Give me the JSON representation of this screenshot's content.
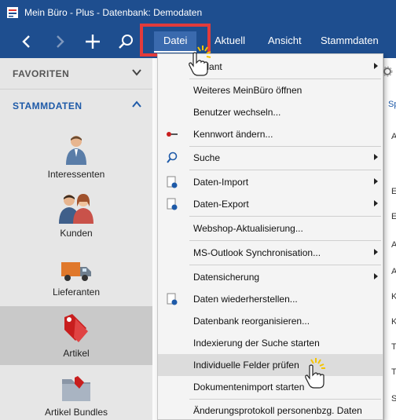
{
  "window": {
    "title": "Mein Büro - Plus - Datenbank: Demodaten"
  },
  "nav": {
    "tabs": [
      "Datei",
      "Aktuell",
      "Ansicht",
      "Stammdaten"
    ]
  },
  "sidebar": {
    "favorites_label": "FAVORITEN",
    "stammdaten_label": "STAMMDATEN",
    "items": [
      "Interessenten",
      "Kunden",
      "Lieferanten",
      "Artikel",
      "Artikel Bundles"
    ],
    "selected": "Artikel"
  },
  "menu": {
    "items": [
      {
        "label": "andant",
        "submenu": true
      },
      {
        "label": "Weiteres MeinBüro öffnen"
      },
      {
        "label": "Benutzer wechseln..."
      },
      {
        "label": "Kennwort ändern...",
        "icon": "key-icon"
      },
      {
        "label": "Suche",
        "icon": "search-icon",
        "submenu": true
      },
      {
        "label": "Daten-Import",
        "icon": "import-icon",
        "submenu": true
      },
      {
        "label": "Daten-Export",
        "icon": "export-icon",
        "submenu": true
      },
      {
        "label": "Webshop-Aktualisierung..."
      },
      {
        "label": "MS-Outlook Synchronisation...",
        "submenu": true
      },
      {
        "label": "Datensicherung",
        "submenu": true
      },
      {
        "label": "Daten wiederherstellen...",
        "icon": "restore-icon"
      },
      {
        "label": "Datenbank reorganisieren..."
      },
      {
        "label": "Indexierung der Suche starten"
      },
      {
        "label": "Individuelle Felder prüfen",
        "highlighted": true
      },
      {
        "label": "Dokumentenimport starten"
      },
      {
        "label": "Änderungsprotokoll personenbzg. Daten"
      }
    ]
  },
  "background_letters": [
    "Sp",
    "A",
    "E",
    "E",
    "A",
    "A",
    "K",
    "K",
    "T",
    "T",
    "S"
  ],
  "colors": {
    "titlebar": "#1e4e8f",
    "accent": "#1e5aa8",
    "highlight_box": "#e23b3b"
  }
}
